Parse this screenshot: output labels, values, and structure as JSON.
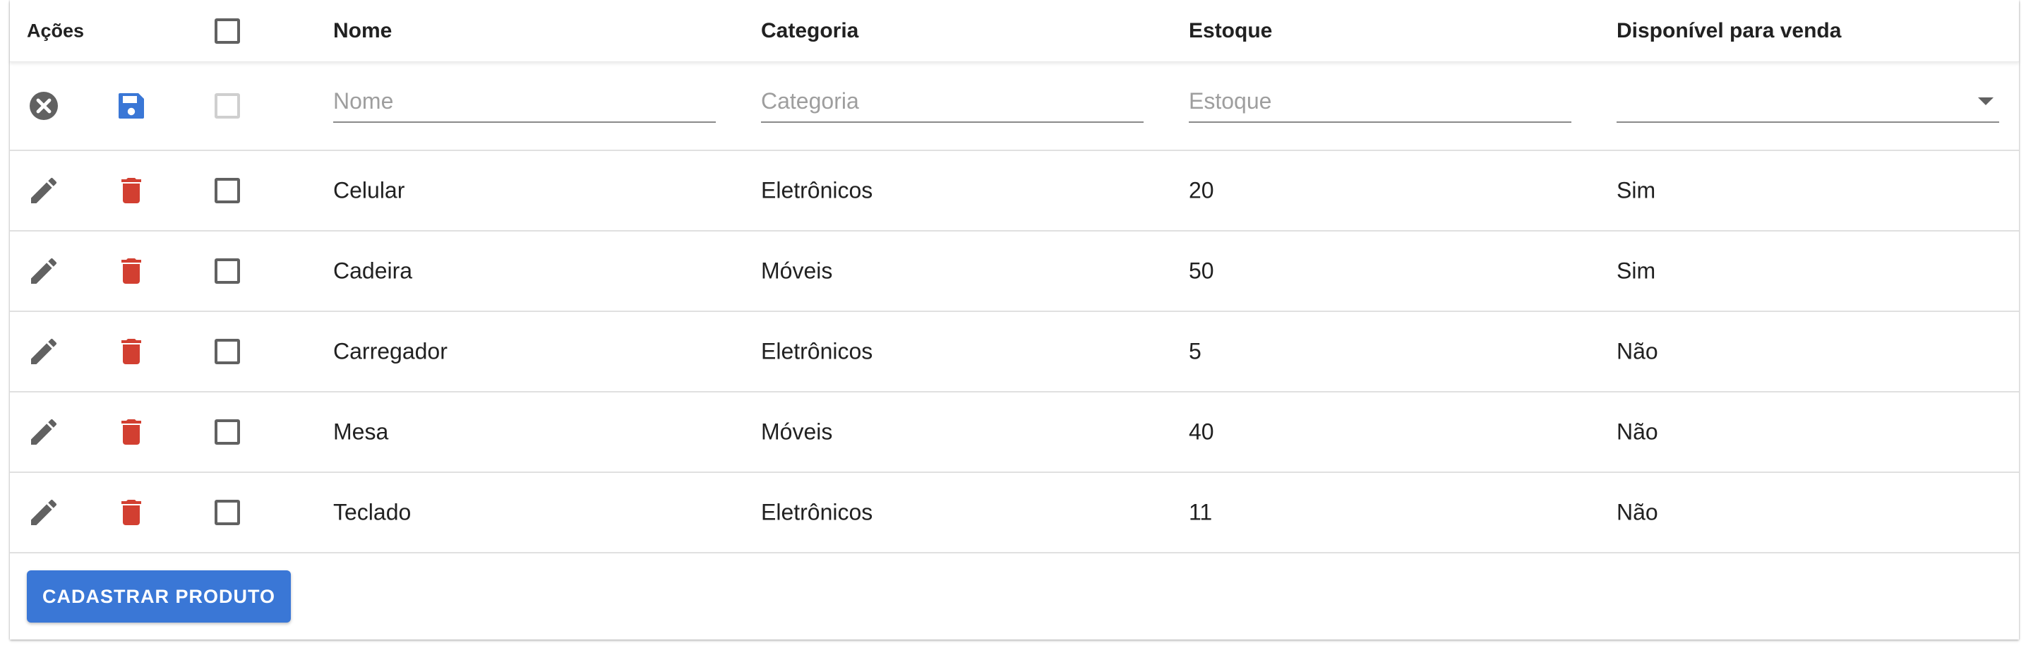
{
  "header": {
    "acoes": "Ações",
    "nome": "Nome",
    "categoria": "Categoria",
    "estoque": "Estoque",
    "disponivel": "Disponível para venda"
  },
  "new_row": {
    "nome_placeholder": "Nome",
    "categoria_placeholder": "Categoria",
    "estoque_placeholder": "Estoque",
    "disponivel_value": ""
  },
  "rows": [
    {
      "nome": "Celular",
      "categoria": "Eletrônicos",
      "estoque": "20",
      "disponivel": "Sim"
    },
    {
      "nome": "Cadeira",
      "categoria": "Móveis",
      "estoque": "50",
      "disponivel": "Sim"
    },
    {
      "nome": "Carregador",
      "categoria": "Eletrônicos",
      "estoque": "5",
      "disponivel": "Não"
    },
    {
      "nome": "Mesa",
      "categoria": "Móveis",
      "estoque": "40",
      "disponivel": "Não"
    },
    {
      "nome": "Teclado",
      "categoria": "Eletrônicos",
      "estoque": "11",
      "disponivel": "Não"
    }
  ],
  "footer": {
    "add_button": "CADASTRAR PRODUTO"
  },
  "colors": {
    "delete": "#d23f31",
    "save": "#3a77d6",
    "cancel": "#616161",
    "edit": "#616161",
    "button": "#3a77d6"
  },
  "icons": {
    "cancel": "cancel-icon",
    "save": "save-icon",
    "edit": "pencil-icon",
    "delete": "trash-icon"
  }
}
